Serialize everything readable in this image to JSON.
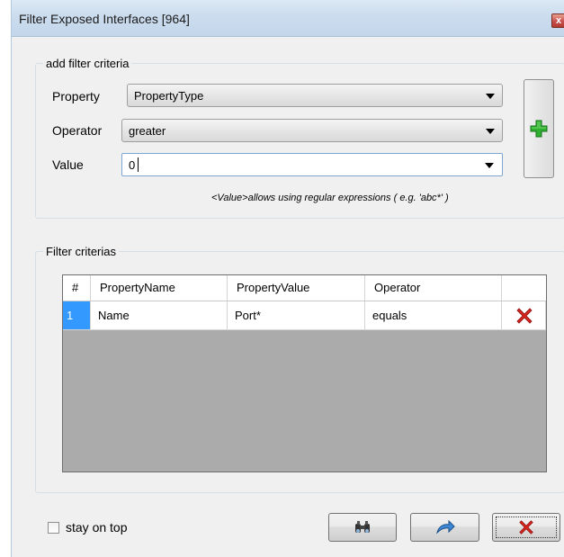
{
  "window": {
    "title": "Filter Exposed Interfaces [964]",
    "close_label": "x"
  },
  "criteria_group": {
    "legend": "add filter criteria",
    "property_label": "Property",
    "property_value": "PropertyType",
    "operator_label": "Operator",
    "operator_value": "greater",
    "value_label": "Value",
    "value_input": "0",
    "hint": "<Value>allows using regular expressions ( e.g. 'abc*' )",
    "add_icon": "plus-icon"
  },
  "filter_group": {
    "legend": "Filter criterias",
    "columns": [
      "#",
      "PropertyName",
      "PropertyValue",
      "Operator"
    ],
    "rows": [
      {
        "num": "1",
        "name": "Name",
        "value": "Port*",
        "operator": "equals",
        "delete_icon": "delete-x-icon"
      }
    ]
  },
  "footer": {
    "stay_on_top_label": "stay on top",
    "stay_on_top_checked": false,
    "buttons": [
      "binoculars-icon",
      "apply-arrow-icon",
      "cancel-x-icon"
    ]
  },
  "colors": {
    "titlebar": "#cbdcee",
    "selection": "#3399ff",
    "add_green": "#27a32b",
    "delete_red": "#d81e1e"
  }
}
